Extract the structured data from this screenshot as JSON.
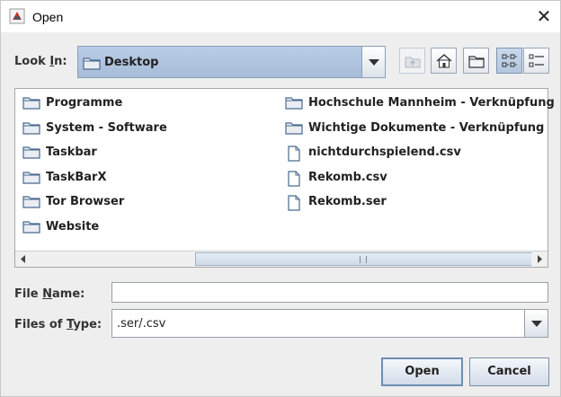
{
  "window": {
    "title": "Open",
    "close_glyph": "✕"
  },
  "look_in": {
    "label_pre": "Look ",
    "label_mn": "I",
    "label_post": "n:",
    "value": "Desktop"
  },
  "toolbar": [
    {
      "name": "up-one-level-icon",
      "disabled": true
    },
    {
      "name": "home-icon",
      "disabled": false
    },
    {
      "name": "new-folder-icon",
      "disabled": false
    },
    {
      "name": "list-view-icon",
      "selected": true
    },
    {
      "name": "details-view-icon",
      "selected": false
    }
  ],
  "files": {
    "col1": [
      {
        "name": "Programme",
        "type": "folder"
      },
      {
        "name": "System  - Software",
        "type": "folder"
      },
      {
        "name": "Taskbar",
        "type": "folder"
      },
      {
        "name": "TaskBarX",
        "type": "folder"
      },
      {
        "name": "Tor Browser",
        "type": "folder"
      },
      {
        "name": "Website",
        "type": "folder"
      }
    ],
    "col2": [
      {
        "name": "Hochschule Mannheim - Verknüpfung",
        "type": "folder"
      },
      {
        "name": "Wichtige Dokumente - Verknüpfung",
        "type": "folder"
      },
      {
        "name": "nichtdurchspielend.csv",
        "type": "file"
      },
      {
        "name": "Rekomb.csv",
        "type": "file"
      },
      {
        "name": "Rekomb.ser",
        "type": "file"
      }
    ]
  },
  "file_name": {
    "label_pre": "File ",
    "label_mn": "N",
    "label_post": "ame:",
    "value": ""
  },
  "file_type": {
    "label_pre": "Files of ",
    "label_mn": "T",
    "label_post": "ype:",
    "value": ".ser/.csv"
  },
  "buttons": {
    "open": "Open",
    "cancel": "Cancel"
  },
  "colors": {
    "selection": "#b3c7df",
    "folder": "#4a6a8e"
  }
}
